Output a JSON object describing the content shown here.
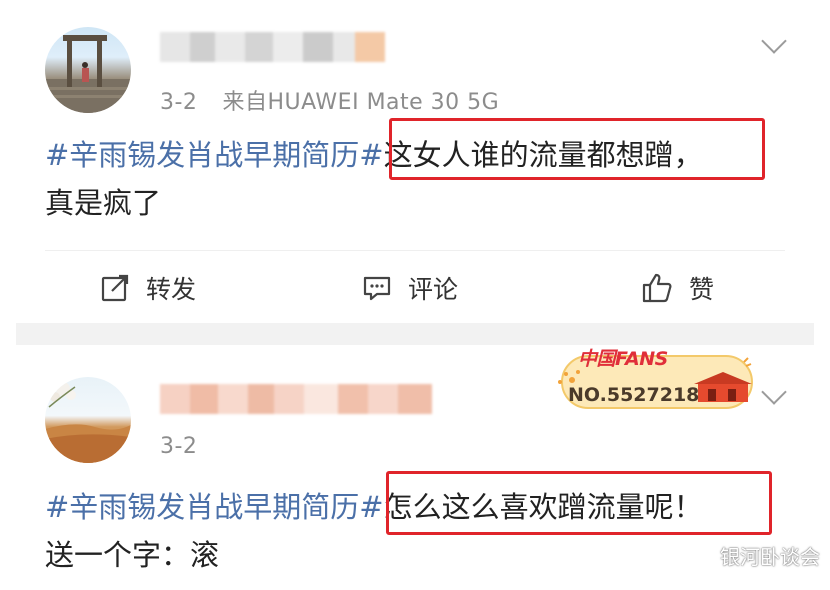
{
  "post1": {
    "date": "3-2",
    "source": "来自HUAWEI Mate 30 5G",
    "hashtag": "#辛雨锡发肖战早期简历#",
    "text_line1": "这女人谁的流量都想蹭，",
    "text_line2": "真是疯了"
  },
  "actions": {
    "repost": "转发",
    "comment": "评论",
    "like": "赞"
  },
  "post2": {
    "date": "3-2",
    "hashtag": "#辛雨锡发肖战早期简历#",
    "text_line1": "怎么这么喜欢蹭流量呢！",
    "text_line2": "送一个字：滚",
    "badge_logo": "中国FANS",
    "badge_number": "NO.5527218"
  },
  "watermark": "银河卧谈会",
  "colors": {
    "hashtag": "#4b70a8",
    "highlight_box": "#e0242a"
  }
}
